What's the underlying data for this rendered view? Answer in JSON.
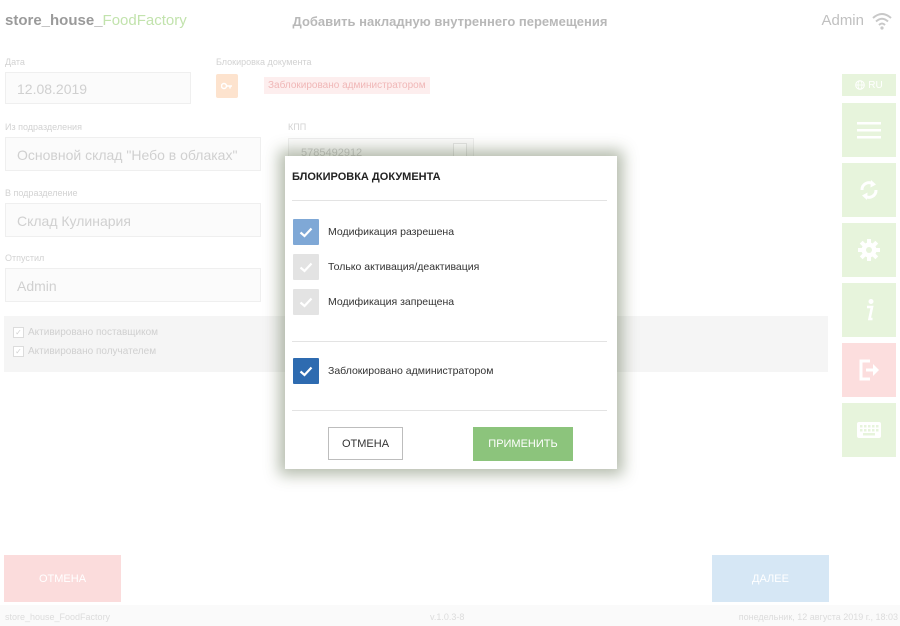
{
  "header": {
    "logo_main": "store_house_",
    "logo_accent": "FoodFactory",
    "title": "Добавить накладную внутреннего перемещения",
    "user": "Admin"
  },
  "form": {
    "date_label": "Дата",
    "date_value": "12.08.2019",
    "lock_label": "Блокировка документа",
    "lock_status": "Заблокировано администратором",
    "from_label": "Из подразделения",
    "from_value": "Основной склад \"Небо в облаках\"",
    "kpp_label": "КПП",
    "kpp_value": "5785492912",
    "to_label": "В подразделение",
    "to_value": "Склад Кулинария",
    "released_label": "Отпустил",
    "released_value": "Admin",
    "activated_supplier": "Активировано поставщиком",
    "activated_receiver": "Активировано получателем"
  },
  "sidebar": {
    "lang": "RU"
  },
  "bottom": {
    "cancel": "ОТМЕНА",
    "next": "ДАЛЕЕ"
  },
  "footer": {
    "left": "store_house_FoodFactory",
    "version": "v.1.0.3-8",
    "datetime": "понедельник, 12 августа 2019 г., 18:03"
  },
  "dialog": {
    "title": "БЛОКИРОВКА ДОКУМЕНТА",
    "options": [
      {
        "label": "Модификация разрешена",
        "checked": true
      },
      {
        "label": "Только активация/деактивация",
        "checked": false
      },
      {
        "label": "Модификация запрещена",
        "checked": false
      }
    ],
    "admin_lock": {
      "label": "Заблокировано администратором",
      "checked": true
    },
    "cancel": "ОТМЕНА",
    "apply": "ПРИМЕНИТЬ"
  },
  "colors": {
    "accent_green": "#8cc47c",
    "checkbox_blue": "#7fa8d6",
    "checkbox_darkblue": "#2e6bb0",
    "danger_light": "#fbdcdc"
  }
}
